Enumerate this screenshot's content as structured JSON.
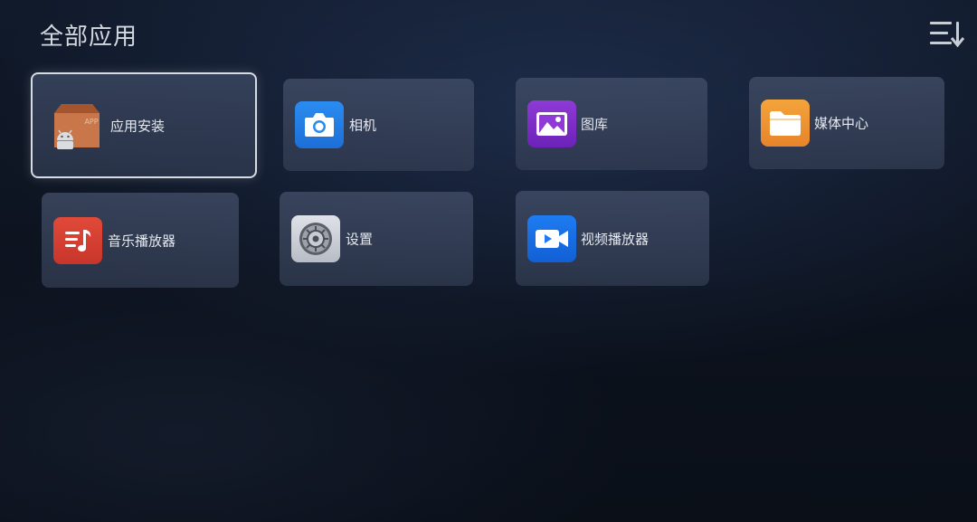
{
  "header": {
    "title": "全部应用",
    "menu_icon": "sort-menu-icon"
  },
  "apps": [
    {
      "label": "应用安装",
      "icon": "app-install-icon",
      "focused": true
    },
    {
      "label": "相机",
      "icon": "camera-icon",
      "focused": false
    },
    {
      "label": "图库",
      "icon": "gallery-icon",
      "focused": false
    },
    {
      "label": "媒体中心",
      "icon": "folder-icon",
      "focused": false
    },
    {
      "label": "音乐播放器",
      "icon": "music-player-icon",
      "focused": false
    },
    {
      "label": "设置",
      "icon": "settings-gear-icon",
      "focused": false
    },
    {
      "label": "视频播放器",
      "icon": "video-player-icon",
      "focused": false
    }
  ],
  "install_icon_text": "APP",
  "colors": {
    "background": "#0d1320",
    "tile": "#424e68",
    "focus_border": "#d6dbe4",
    "camera": "#2a8cf0",
    "gallery": "#8f3ad6",
    "media": "#f3a43b",
    "music": "#e04a3a",
    "video": "#1e7cf2"
  }
}
